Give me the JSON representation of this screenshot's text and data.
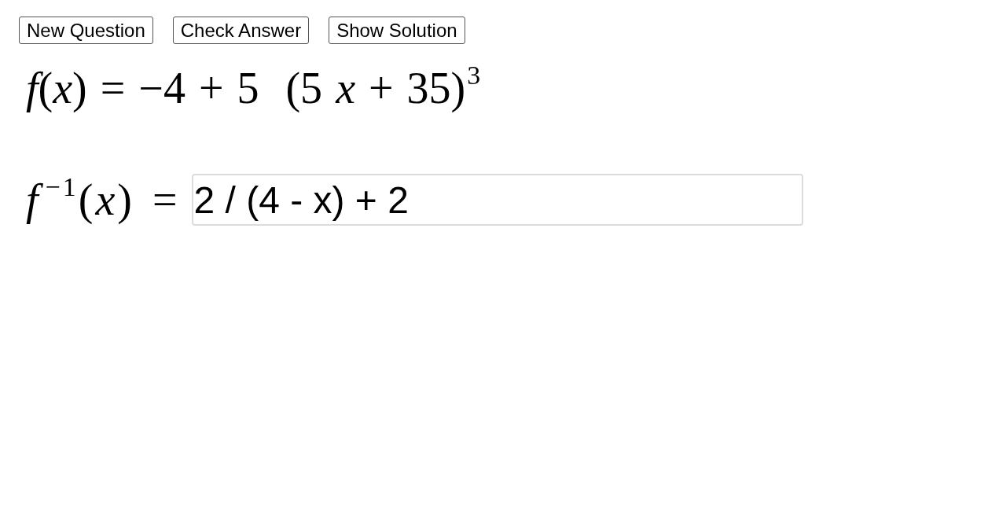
{
  "buttons": [
    {
      "label": "New Question"
    },
    {
      "label": "Check Answer"
    },
    {
      "label": "Show Solution"
    }
  ],
  "function_formula": "*f*(*x*) = −4 + 5  (5 *x* + 35)$^{3}$",
  "inverse_answer": {
    "label": "*f*$^{−1}$(*x*) =",
    "value": "2 / (4 - x) + 2"
  }
}
